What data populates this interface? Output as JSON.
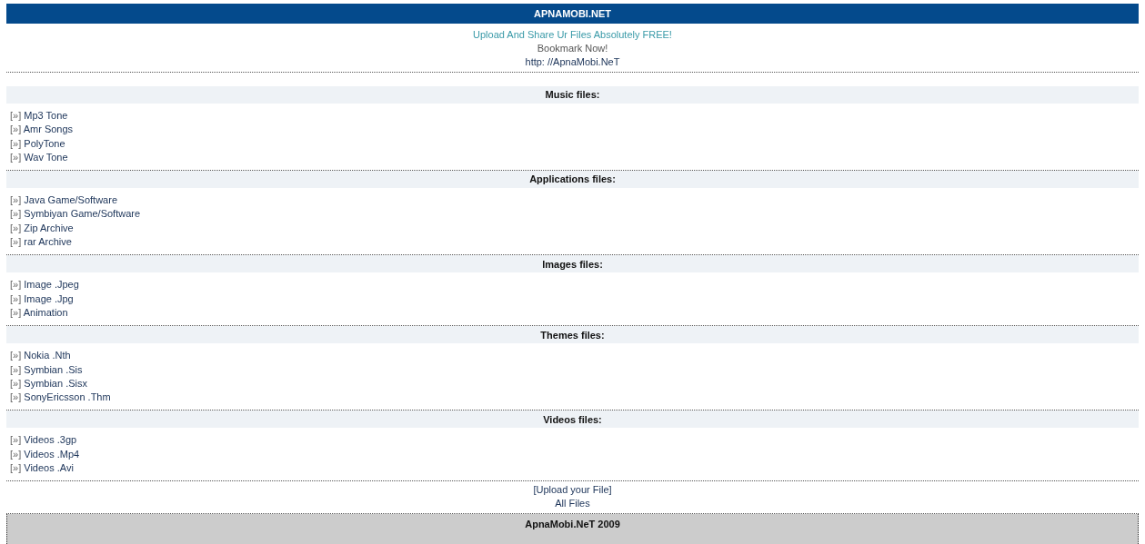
{
  "header": {
    "title": "APNAMOBI.NET"
  },
  "intro": {
    "tagline": "Upload And Share Ur Files Absolutely FREE!",
    "bookmark": "Bookmark Now!",
    "url": "http: //ApnaMobi.NeT"
  },
  "sections": [
    {
      "title": "Music files:",
      "items": [
        {
          "marker": "[»]",
          "label": "Mp3 Tone"
        },
        {
          "marker": "[»]",
          "label": "Amr Songs"
        },
        {
          "marker": "[»]",
          "label": "PolyTone"
        },
        {
          "marker": "[»]",
          "label": "Wav Tone"
        }
      ]
    },
    {
      "title": "Applications files:",
      "items": [
        {
          "marker": "[»]",
          "label": "Java Game/Software"
        },
        {
          "marker": "[»]",
          "label": "Symbiyan Game/Software"
        },
        {
          "marker": "[»]",
          "label": "Zip Archive"
        },
        {
          "marker": "[»]",
          "label": "rar Archive"
        }
      ]
    },
    {
      "title": "Images files:",
      "items": [
        {
          "marker": "[»]",
          "label": "Image .Jpeg"
        },
        {
          "marker": "[»]",
          "label": "Image .Jpg"
        },
        {
          "marker": "[»]",
          "label": "Animation"
        }
      ]
    },
    {
      "title": "Themes files:",
      "items": [
        {
          "marker": "[»]",
          "label": "Nokia .Nth"
        },
        {
          "marker": "[»]",
          "label": "Symbian .Sis"
        },
        {
          "marker": "[»]",
          "label": "Symbian .Sisx"
        },
        {
          "marker": "[»]",
          "label": "SonyEricsson .Thm"
        }
      ]
    },
    {
      "title": "Videos files:",
      "items": [
        {
          "marker": "[»]",
          "label": "Videos .3gp"
        },
        {
          "marker": "[»]",
          "label": "Videos .Mp4"
        },
        {
          "marker": "[»]",
          "label": "Videos .Avi"
        }
      ]
    }
  ],
  "footer_links": [
    {
      "label": "[Upload your File]"
    },
    {
      "label": "All Files"
    }
  ],
  "copyright": "ApnaMobi.NeT 2009"
}
